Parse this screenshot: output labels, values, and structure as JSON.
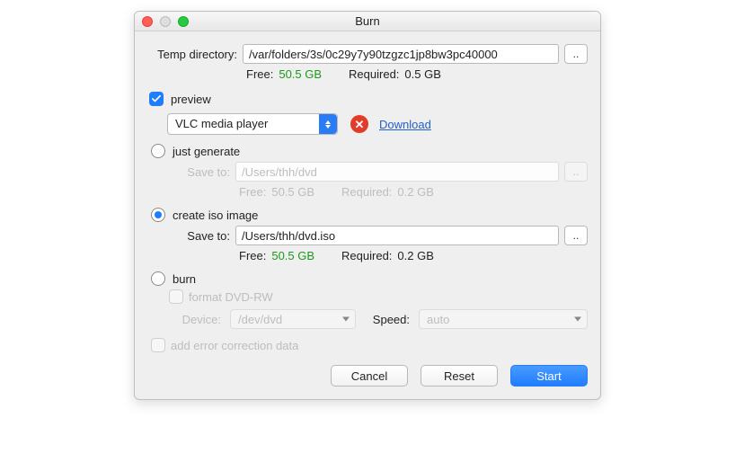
{
  "window": {
    "title": "Burn"
  },
  "temp": {
    "label": "Temp directory:",
    "path": "/var/folders/3s/0c29y7y90tzgzc1jp8bw3pc40000",
    "browse": "..",
    "free_label": "Free:",
    "free_value": "50.5 GB",
    "req_label": "Required:",
    "req_value": "0.5 GB"
  },
  "preview": {
    "label": "preview",
    "player": "VLC media player",
    "download": "Download"
  },
  "just_generate": {
    "label": "just generate",
    "save_label": "Save to:",
    "path": "/Users/thh/dvd",
    "browse": "..",
    "free_label": "Free:",
    "free_value": "50.5 GB",
    "req_label": "Required:",
    "req_value": "0.2 GB"
  },
  "create_iso": {
    "label": "create iso image",
    "save_label": "Save to:",
    "path": "/Users/thh/dvd.iso",
    "browse": "..",
    "free_label": "Free:",
    "free_value": "50.5 GB",
    "req_label": "Required:",
    "req_value": "0.2 GB"
  },
  "burn": {
    "label": "burn",
    "format_label": "format DVD-RW",
    "device_label": "Device:",
    "device_value": "/dev/dvd",
    "speed_label": "Speed:",
    "speed_value": "auto"
  },
  "err_correct": {
    "label": "add error correction data"
  },
  "buttons": {
    "cancel": "Cancel",
    "reset": "Reset",
    "start": "Start"
  }
}
